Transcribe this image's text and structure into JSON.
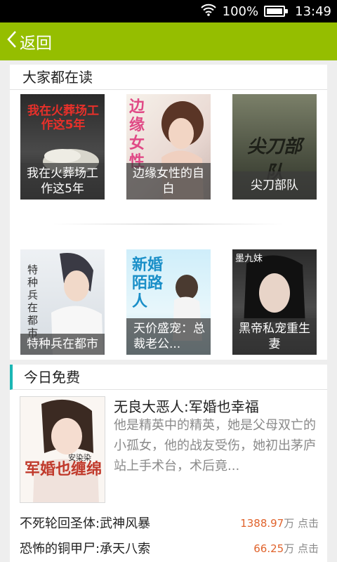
{
  "status_bar": {
    "battery": "100%",
    "time": "13:49",
    "icons": [
      "wifi-icon",
      "battery-icon"
    ]
  },
  "header": {
    "back_label": "返回",
    "color": "#95be00"
  },
  "popular": {
    "title": "大家都在读",
    "books": [
      {
        "caption": "我在火葬场工作这5年",
        "cover_text": "我在火葬场工作这5年"
      },
      {
        "caption": "边缘女性的自白",
        "cover_text": "边缘女性"
      },
      {
        "caption": "尖刀部队",
        "cover_text": "尖刀部队"
      },
      {
        "caption": "特种兵在都市",
        "cover_text": "特种兵在都市"
      },
      {
        "caption": "天价盛宠：总裁老公...",
        "cover_text": "新婚陌路人"
      },
      {
        "caption": "黑帝私宠重生妻",
        "cover_text": "墨九妹"
      }
    ]
  },
  "free_today": {
    "title": "今日免费",
    "accent": "#1bb6b4",
    "feature": {
      "title": "无良大恶人:军婚也幸福",
      "description": "他是精英中的精英，她是父母双亡的小孤女，他的战友受伤，她初出茅庐站上手术台，术后竟...",
      "cover_text": "军婚也缠绵",
      "cover_author": "安染染"
    },
    "list": [
      {
        "name": "不死轮回圣体:武神风暴",
        "count": "1388.97",
        "unit": "万 点击"
      },
      {
        "name": "恐怖的铜甲尸:承天八索",
        "count": "66.25",
        "unit": "万 点击"
      }
    ],
    "count_color": "#e0632c"
  }
}
